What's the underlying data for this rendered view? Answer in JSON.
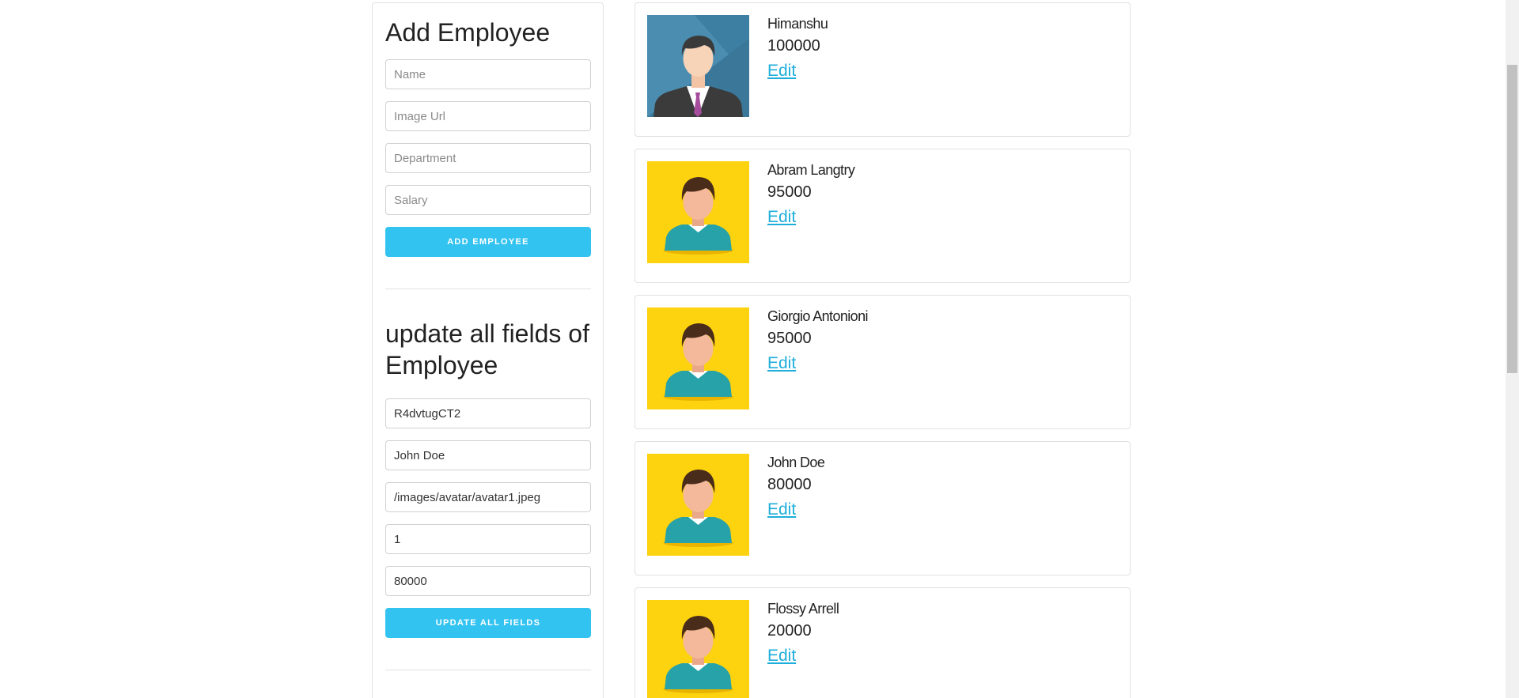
{
  "add_form": {
    "title": "Add Employee",
    "name_placeholder": "Name",
    "image_placeholder": "Image Url",
    "department_placeholder": "Department",
    "salary_placeholder": "Salary",
    "submit_label": "ADD EMPLOYEE"
  },
  "update_form": {
    "title_line1": "update all fields of",
    "title_line2": "Employee",
    "id_value": "R4dvtugCT2",
    "name_value": "John Doe",
    "image_value": "/images/avatar/avatar1.jpeg",
    "department_value": "1",
    "salary_value": "80000",
    "submit_label": "UPDATE ALL FIELDS"
  },
  "employees": [
    {
      "name": "Himanshu",
      "salary": "100000",
      "edit_label": "Edit",
      "avatar": "businessman-icon"
    },
    {
      "name": "Abram Langtry",
      "salary": "95000",
      "edit_label": "Edit",
      "avatar": "person-avatar-icon"
    },
    {
      "name": "Giorgio Antonioni",
      "salary": "95000",
      "edit_label": "Edit",
      "avatar": "person-avatar-icon"
    },
    {
      "name": "John Doe",
      "salary": "80000",
      "edit_label": "Edit",
      "avatar": "person-avatar-icon"
    },
    {
      "name": "Flossy Arrell",
      "salary": "20000",
      "edit_label": "Edit",
      "avatar": "person-avatar-icon"
    }
  ],
  "colors": {
    "button": "#33c3f0",
    "link": "#1eaedb",
    "avatar_bg_business": "#4a8db0",
    "avatar_bg_person": "#fdd20e"
  }
}
